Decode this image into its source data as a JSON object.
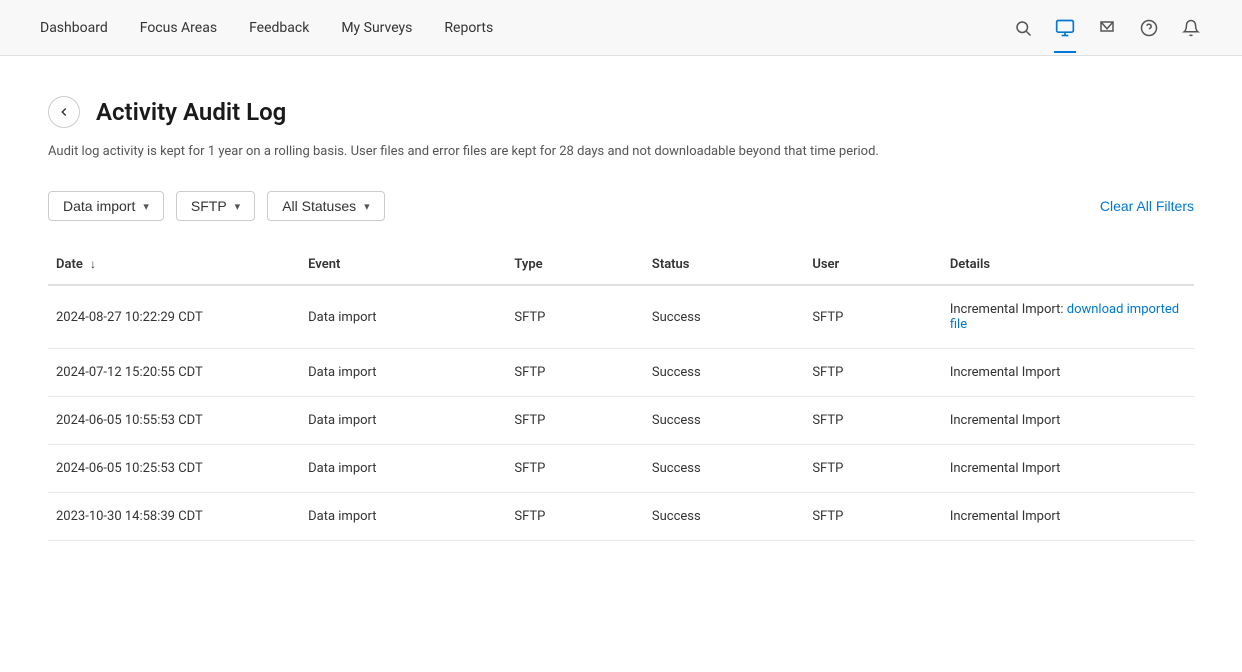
{
  "nav": {
    "links": [
      {
        "label": "Dashboard",
        "active": false
      },
      {
        "label": "Focus Areas",
        "active": false
      },
      {
        "label": "Feedback",
        "active": false
      },
      {
        "label": "My Surveys",
        "active": false
      },
      {
        "label": "Reports",
        "active": false
      }
    ],
    "icons": [
      {
        "name": "search-icon",
        "symbol": "🔍",
        "active": false
      },
      {
        "name": "monitor-icon",
        "symbol": "🖥",
        "active": true
      },
      {
        "name": "inbox-icon",
        "symbol": "✉",
        "active": false
      },
      {
        "name": "help-icon",
        "symbol": "?",
        "active": false,
        "circle": true
      },
      {
        "name": "notification-icon",
        "symbol": "🔔",
        "active": false
      }
    ]
  },
  "page": {
    "title": "Activity Audit Log",
    "subtitle": "Audit log activity is kept for 1 year on a rolling basis. User files and error files are kept for 28 days and not downloadable beyond that time period."
  },
  "filters": {
    "filter1_label": "Data import",
    "filter2_label": "SFTP",
    "filter3_label": "All Statuses",
    "clear_label": "Clear All Filters"
  },
  "table": {
    "columns": [
      {
        "key": "date",
        "label": "Date",
        "sortable": true
      },
      {
        "key": "event",
        "label": "Event",
        "sortable": false
      },
      {
        "key": "type",
        "label": "Type",
        "sortable": false
      },
      {
        "key": "status",
        "label": "Status",
        "sortable": false
      },
      {
        "key": "user",
        "label": "User",
        "sortable": false
      },
      {
        "key": "details",
        "label": "Details",
        "sortable": false
      }
    ],
    "rows": [
      {
        "date": "2024-08-27 10:22:29 CDT",
        "event": "Data import",
        "type": "SFTP",
        "status": "Success",
        "user": "SFTP",
        "details_text": "Incremental Import: ",
        "details_link": "download imported file",
        "has_link": true
      },
      {
        "date": "2024-07-12 15:20:55 CDT",
        "event": "Data import",
        "type": "SFTP",
        "status": "Success",
        "user": "SFTP",
        "details_text": "Incremental Import",
        "details_link": "",
        "has_link": false
      },
      {
        "date": "2024-06-05 10:55:53 CDT",
        "event": "Data import",
        "type": "SFTP",
        "status": "Success",
        "user": "SFTP",
        "details_text": "Incremental Import",
        "details_link": "",
        "has_link": false
      },
      {
        "date": "2024-06-05 10:25:53 CDT",
        "event": "Data import",
        "type": "SFTP",
        "status": "Success",
        "user": "SFTP",
        "details_text": "Incremental Import",
        "details_link": "",
        "has_link": false
      },
      {
        "date": "2023-10-30 14:58:39 CDT",
        "event": "Data import",
        "type": "SFTP",
        "status": "Success",
        "user": "SFTP",
        "details_text": "Incremental Import",
        "details_link": "",
        "has_link": false
      }
    ]
  }
}
